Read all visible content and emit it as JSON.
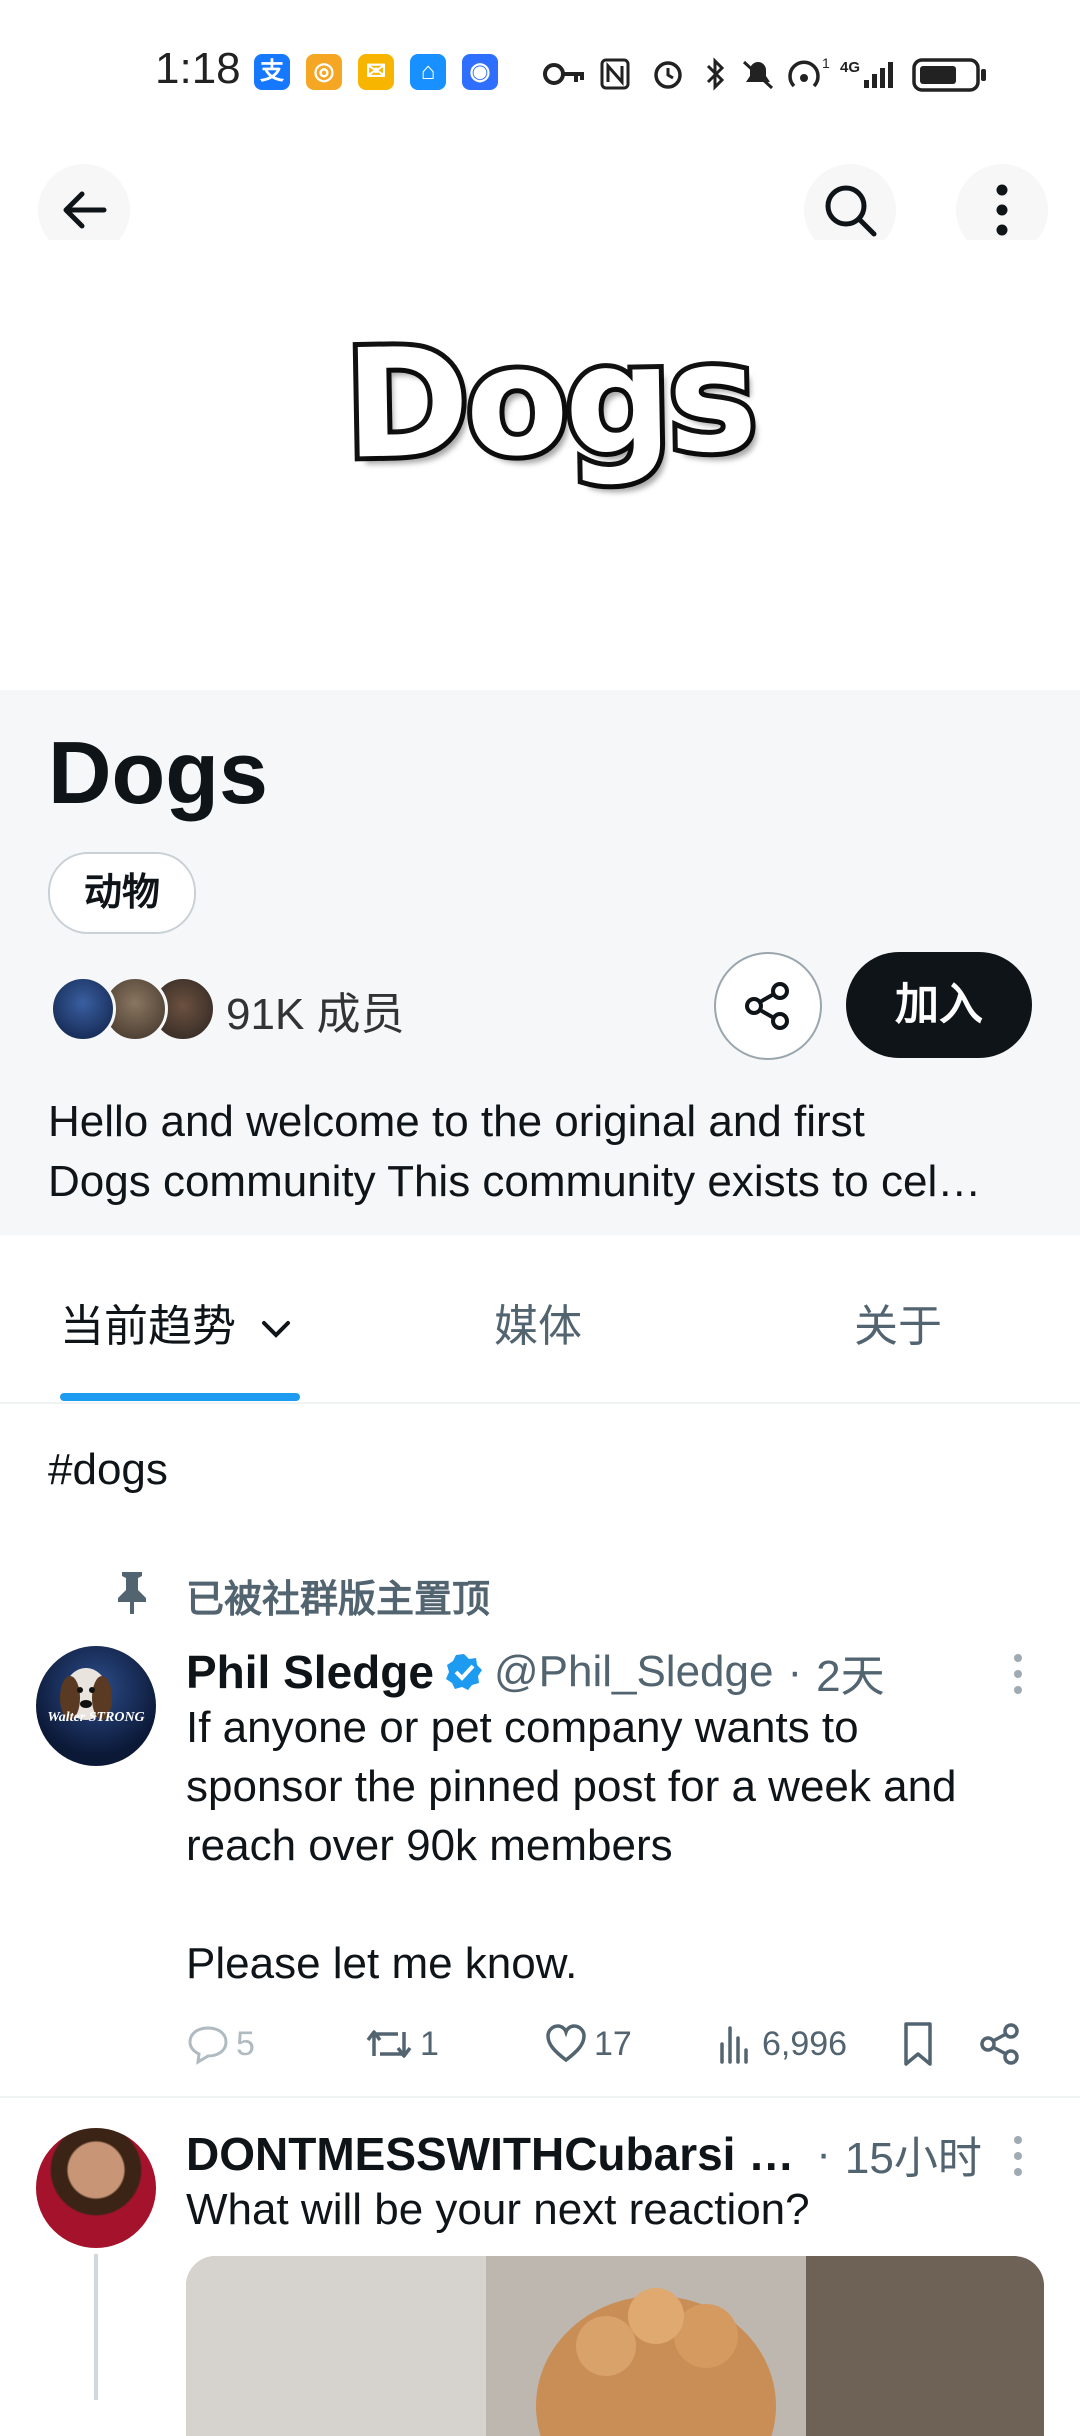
{
  "status_bar": {
    "time": "1:18",
    "app_icons": [
      {
        "name": "alipay-icon",
        "glyph": "支",
        "color": "#1677ff"
      },
      {
        "name": "app-icon-2",
        "glyph": "◎",
        "color": "#f5a623"
      },
      {
        "name": "mail-icon",
        "glyph": "✉",
        "color": "#f7b500"
      },
      {
        "name": "shopping-bag-icon",
        "glyph": "⌂",
        "color": "#1890ff"
      },
      {
        "name": "app-icon-5",
        "glyph": "◉",
        "color": "#2f6fff"
      }
    ],
    "signal_text": "4G"
  },
  "header": {
    "back_icon": "arrow-left-icon",
    "search_icon": "search-icon",
    "more_icon": "more-vertical-icon"
  },
  "community": {
    "banner_text": "Dogs",
    "name": "Dogs",
    "category": "动物",
    "members": "91K 成员",
    "join_label": "加入",
    "description_line1": "Hello and welcome to the original and first",
    "description_line2": "Dogs community This community exists to cel…"
  },
  "tabs": [
    {
      "label": "当前趋势",
      "active": true
    },
    {
      "label": "媒体",
      "active": false
    },
    {
      "label": "关于",
      "active": false
    }
  ],
  "hashtag": "#dogs",
  "pinned_post": {
    "pin_label": "已被社群版主置顶",
    "author": "Phil Sledge",
    "handle": "@Phil_Sledge",
    "sep": "·",
    "time": "2天",
    "text_lines": [
      "If anyone or pet company wants to",
      "sponsor the pinned post for a week and",
      "reach over 90k members",
      "",
      "Please let me know."
    ],
    "replies": "5",
    "reposts": "1",
    "likes": "17",
    "views": "6,996",
    "avatar_text": "Walter STRONG"
  },
  "second_post": {
    "author": "DONTMESSWITHCubarsi …",
    "sep": "·",
    "time": "15小时",
    "text": "What will be your next reaction?"
  },
  "colors": {
    "accent": "#1d9bf0",
    "verified": "#1d9bf0",
    "info_bg": "#f5f7f8",
    "join_bg": "#0f1419"
  }
}
